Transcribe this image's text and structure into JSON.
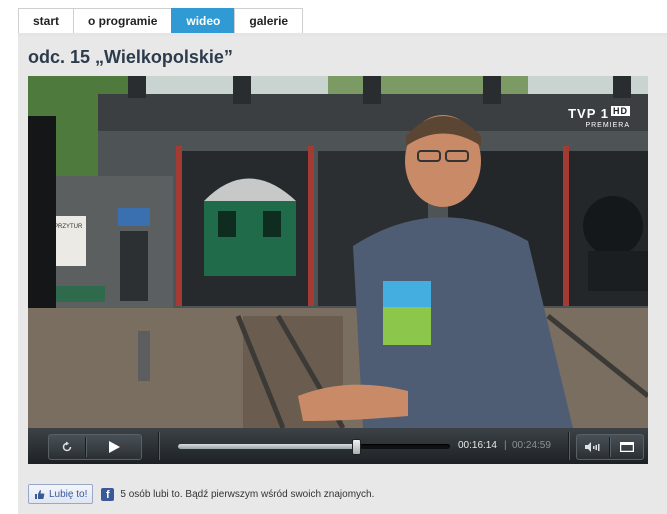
{
  "tabs": [
    {
      "label": "start"
    },
    {
      "label": "o programie"
    },
    {
      "label": "wideo",
      "active": true
    },
    {
      "label": "galerie"
    }
  ],
  "episode": {
    "title": "odc. 15 „Wielkopolskie”"
  },
  "video": {
    "channel_logo": {
      "main": "TVP 1",
      "badge": "HD",
      "sub": "PREMIERA"
    },
    "scene_sign": "SPRZYTUR",
    "player": {
      "current_time": "00:16:14",
      "separator": "|",
      "total_time": "00:24:59",
      "progress": 0.65,
      "icons": {
        "replay": "replay-icon",
        "play": "play-icon",
        "volume": "volume-icon",
        "fullscreen": "fullscreen-icon"
      }
    }
  },
  "social": {
    "like_label": "Lubię to!",
    "text": "5 osób lubi to. Bądź pierwszym wśród swoich znajomych.",
    "fb_glyph": "f",
    "colors": {
      "fb_blue": "#3b5998"
    }
  },
  "colors": {
    "tab_active": "#2f9ad3",
    "title": "#2d3c4c"
  }
}
